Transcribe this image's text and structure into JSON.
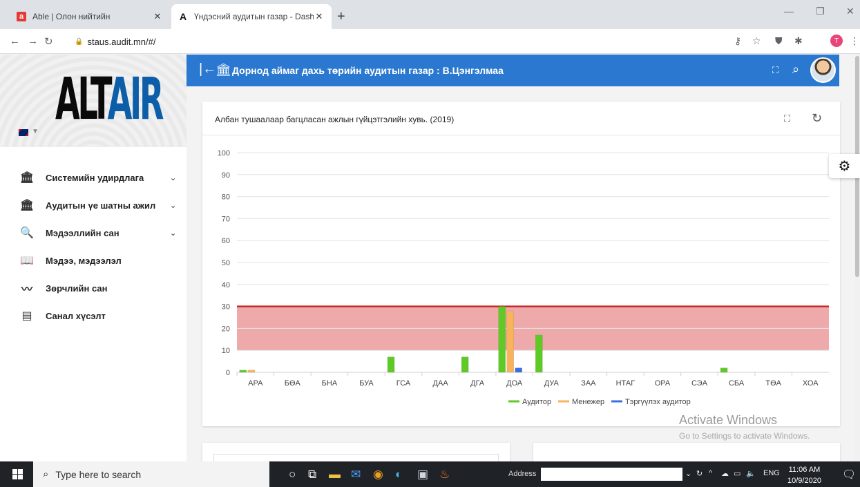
{
  "browser": {
    "tabs": [
      {
        "title": "Able | Олон нийтийн",
        "favicon": "a"
      },
      {
        "title": "Үндэсний аудитын газар - Dashb",
        "favicon": "A"
      }
    ],
    "url": "staus.audit.mn/#/",
    "profile_letter": "T"
  },
  "sidebar": {
    "logo_part1": "ALT",
    "logo_part2": "AIR",
    "items": [
      {
        "label": "Системийн удирдлага",
        "icon": "bank-icon",
        "has_caret": true
      },
      {
        "label": "Аудитын үе шатны ажил",
        "icon": "bank-icon",
        "has_caret": true
      },
      {
        "label": "Мэдээллийн сан",
        "icon": "database-search-icon",
        "has_caret": true
      },
      {
        "label": "Мэдээ, мэдээлэл",
        "icon": "book-icon",
        "has_caret": false
      },
      {
        "label": "Зөрчлийн сан",
        "icon": "trend-icon",
        "has_caret": false
      },
      {
        "label": "Санал хүсэлт",
        "icon": "message-icon",
        "has_caret": false
      }
    ]
  },
  "header": {
    "title": "Дорнод аймаг дахь төрийн аудитын газар : В.Цэнгэлмаа"
  },
  "card": {
    "title": "Албан тушаалаар багцласан ажлын гүйцэтгэлийн хувь. (2019)"
  },
  "chart_data": {
    "type": "bar",
    "categories": [
      "АРА",
      "БӨА",
      "БНА",
      "БУА",
      "ГСА",
      "ДАА",
      "ДГА",
      "ДОА",
      "ДУА",
      "ЗАА",
      "НТАГ",
      "ОРА",
      "СЭА",
      "СБА",
      "ТӨА",
      "ХОА"
    ],
    "series": [
      {
        "name": "Аудитор",
        "color": "#5fc926",
        "values": [
          1,
          0,
          0,
          0,
          7,
          0,
          7,
          30,
          17,
          0,
          0,
          0,
          0,
          2,
          0,
          0
        ]
      },
      {
        "name": "Менежер",
        "color": "#f8b35c",
        "values": [
          1,
          0,
          0,
          0,
          0,
          0,
          0,
          28,
          0,
          0,
          0,
          0,
          0,
          0,
          0,
          0
        ]
      },
      {
        "name": "Тэргүүлэх аудитор",
        "color": "#3b6fe0",
        "values": [
          0,
          0,
          0,
          0,
          0,
          0,
          0,
          2,
          0,
          0,
          0,
          0,
          0,
          0,
          0,
          0
        ]
      }
    ],
    "yticks": [
      0,
      10,
      20,
      30,
      40,
      50,
      60,
      70,
      80,
      90,
      100
    ],
    "ylim": [
      0,
      100
    ],
    "band": {
      "from": 10,
      "to": 30,
      "color": "#eeaaaa"
    },
    "threshold": {
      "value": 30,
      "color": "#c62828"
    },
    "legend": "bottom",
    "grid": true
  },
  "watermark": {
    "line1": "Activate Windows",
    "line2": "Go to Settings to activate Windows."
  },
  "taskbar": {
    "search_placeholder": "Type here to search",
    "address_label": "Address",
    "lang": "ENG",
    "time": "11:06 AM",
    "date": "10/9/2020"
  }
}
